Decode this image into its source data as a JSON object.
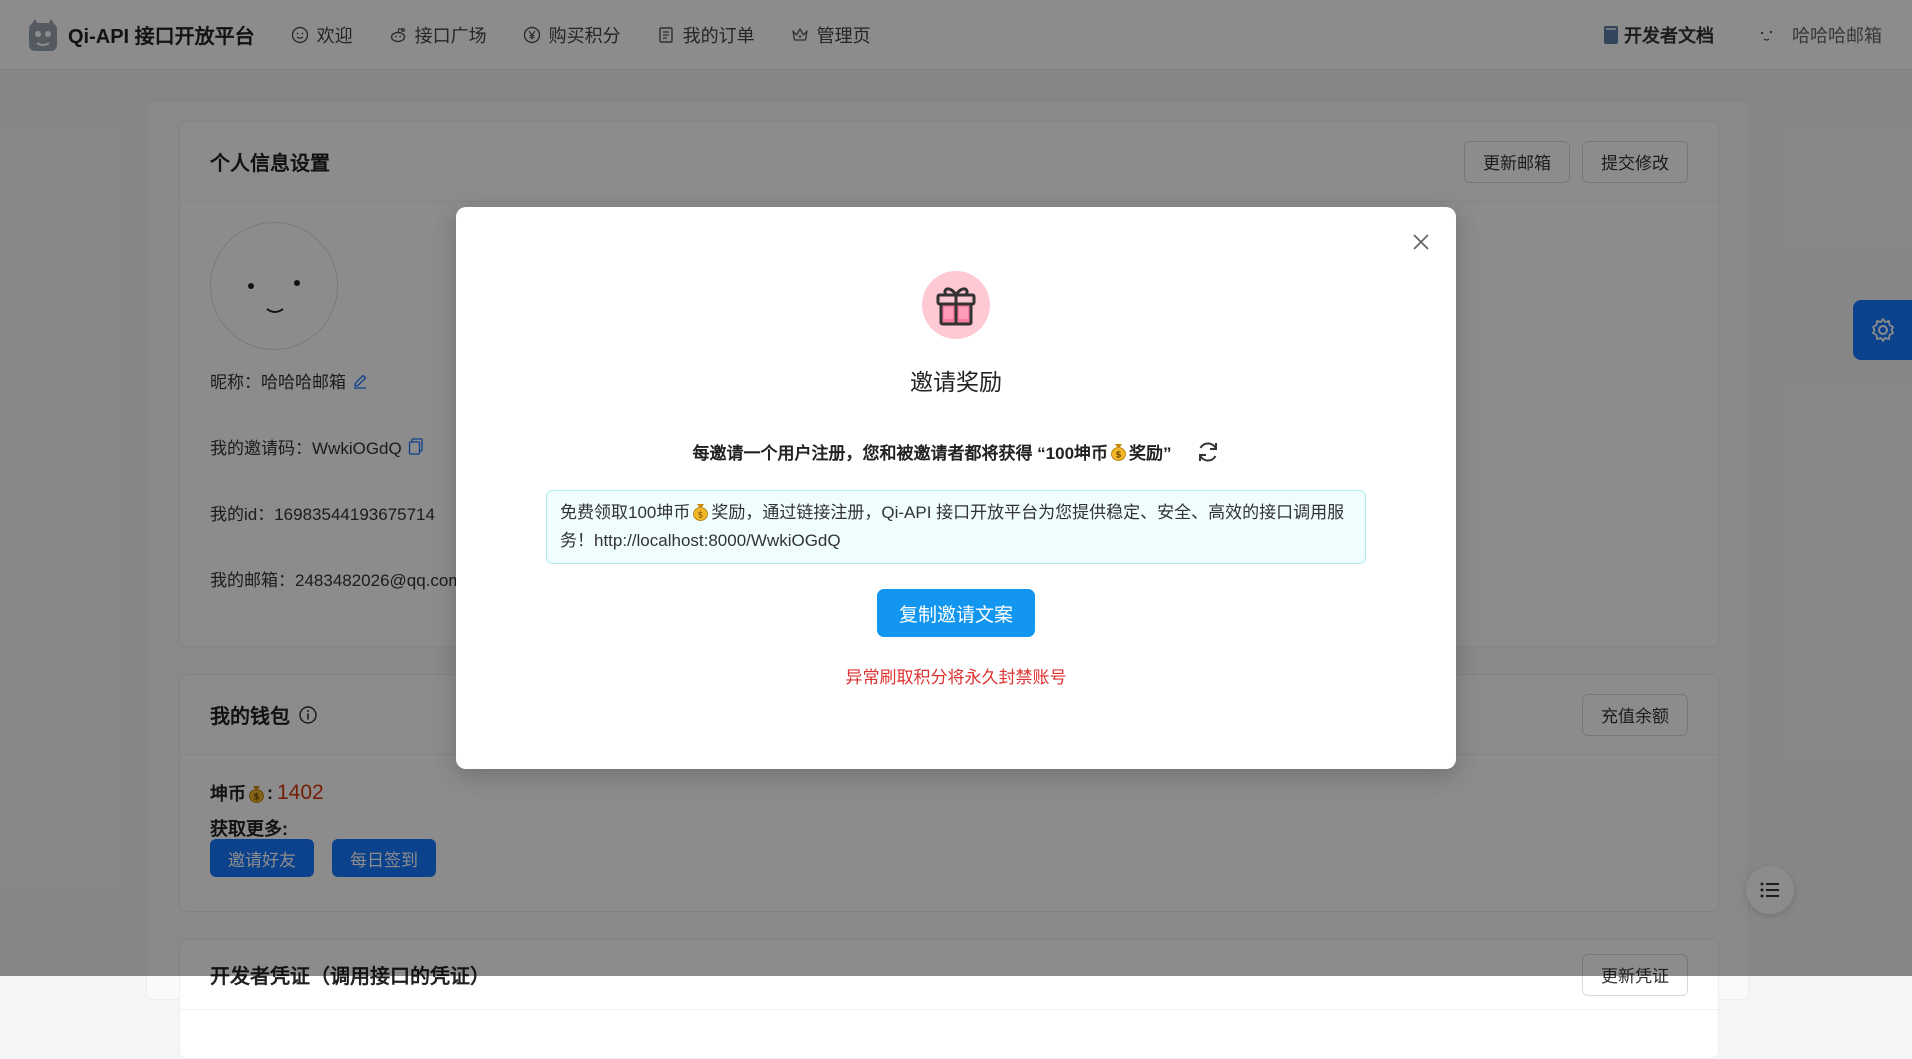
{
  "nav": {
    "brand": "Qi-API 接口开放平台",
    "items": [
      {
        "label": "欢迎",
        "icon": "smile-icon"
      },
      {
        "label": "接口广场",
        "icon": "reddit-icon"
      },
      {
        "label": "购买积分",
        "icon": "yen-circle-icon"
      },
      {
        "label": "我的订单",
        "icon": "document-icon"
      },
      {
        "label": "管理页",
        "icon": "crown-icon"
      }
    ],
    "docs_label": "开发者文档",
    "user_name": "哈哈哈邮箱"
  },
  "profile": {
    "title": "个人信息设置",
    "update_email_btn": "更新邮箱",
    "submit_btn": "提交修改",
    "nickname": "昵称：哈哈哈邮箱",
    "invite_code": "我的邀请码：WwkiOGdQ",
    "user_id": "我的id：16983544193675714",
    "email": "我的邮箱：2483482026@qq.com"
  },
  "wallet": {
    "title": "我的钱包",
    "recharge_btn": "充值余额",
    "coin_label": "坤币",
    "coin_value": "1402",
    "more_label": "获取更多:",
    "invite_btn": "邀请好友",
    "checkin_btn": "每日签到"
  },
  "next_card": {
    "title": "开发者凭证（调用接口的凭证）",
    "btn": "更新凭证"
  },
  "modal": {
    "title": "邀请奖励",
    "reward_prefix": "每邀请一个用户注册，您和被邀请者都将获得 “100坤币",
    "reward_suffix": "奖励”",
    "invite_text_part1": "免费领取100坤币",
    "invite_text_part2": "奖励，通过链接注册，Qi-API 接口开放平台为您提供稳定、安全、高效的接口调用服务！http://localhost:8000/WwkiOGdQ",
    "copy_btn": "复制邀请文案",
    "warning": "异常刷取积分将永久封禁账号"
  },
  "colors": {
    "primary": "#1677ff",
    "copy_button": "#1296f0",
    "warning": "#e03131",
    "coin_value": "#d4380d"
  }
}
